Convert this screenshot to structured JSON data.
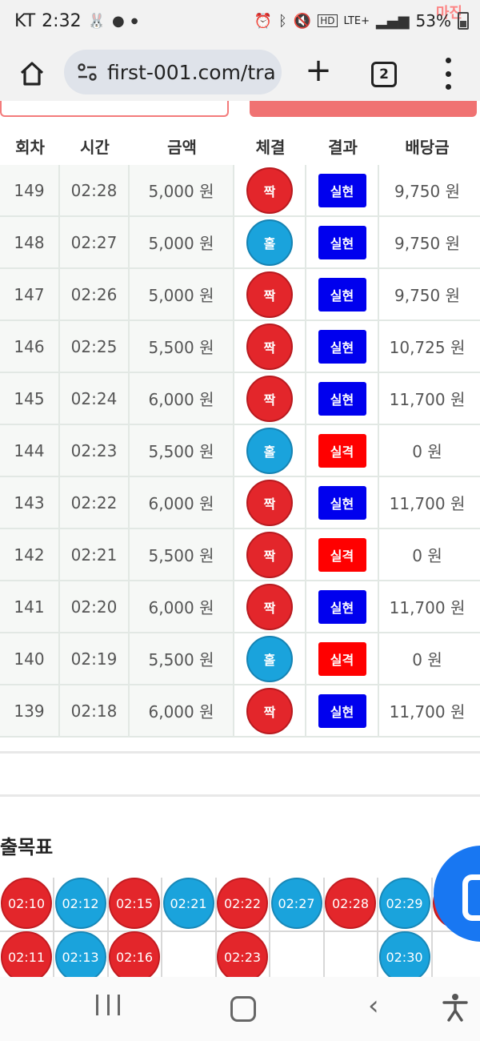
{
  "status_bar": {
    "carrier": "KT",
    "time": "2:32",
    "network": "LTE+",
    "battery": "53%",
    "watermark": "마진"
  },
  "browser": {
    "url": "first-001.com/tra",
    "tab_count": "2"
  },
  "table": {
    "headers": [
      "회차",
      "시간",
      "금액",
      "체결",
      "결과",
      "배당금"
    ],
    "rows": [
      {
        "round": "149",
        "time": "02:28",
        "amount": "5,000 원",
        "pick": "짝",
        "pick_color": "red",
        "result": "실현",
        "result_color": "blue",
        "payout": "9,750 원"
      },
      {
        "round": "148",
        "time": "02:27",
        "amount": "5,000 원",
        "pick": "홀",
        "pick_color": "blue",
        "result": "실현",
        "result_color": "blue",
        "payout": "9,750 원"
      },
      {
        "round": "147",
        "time": "02:26",
        "amount": "5,000 원",
        "pick": "짝",
        "pick_color": "red",
        "result": "실현",
        "result_color": "blue",
        "payout": "9,750 원"
      },
      {
        "round": "146",
        "time": "02:25",
        "amount": "5,500 원",
        "pick": "짝",
        "pick_color": "red",
        "result": "실현",
        "result_color": "blue",
        "payout": "10,725 원"
      },
      {
        "round": "145",
        "time": "02:24",
        "amount": "6,000 원",
        "pick": "짝",
        "pick_color": "red",
        "result": "실현",
        "result_color": "blue",
        "payout": "11,700 원"
      },
      {
        "round": "144",
        "time": "02:23",
        "amount": "5,500 원",
        "pick": "홀",
        "pick_color": "blue",
        "result": "실격",
        "result_color": "red",
        "payout": "0 원"
      },
      {
        "round": "143",
        "time": "02:22",
        "amount": "6,000 원",
        "pick": "짝",
        "pick_color": "red",
        "result": "실현",
        "result_color": "blue",
        "payout": "11,700 원"
      },
      {
        "round": "142",
        "time": "02:21",
        "amount": "5,500 원",
        "pick": "짝",
        "pick_color": "red",
        "result": "실격",
        "result_color": "red",
        "payout": "0 원"
      },
      {
        "round": "141",
        "time": "02:20",
        "amount": "6,000 원",
        "pick": "짝",
        "pick_color": "red",
        "result": "실현",
        "result_color": "blue",
        "payout": "11,700 원"
      },
      {
        "round": "140",
        "time": "02:19",
        "amount": "5,500 원",
        "pick": "홀",
        "pick_color": "blue",
        "result": "실격",
        "result_color": "red",
        "payout": "0 원"
      },
      {
        "round": "139",
        "time": "02:18",
        "amount": "6,000 원",
        "pick": "짝",
        "pick_color": "red",
        "result": "실현",
        "result_color": "blue",
        "payout": "11,700 원"
      }
    ]
  },
  "chart_section": {
    "title": "출목표",
    "columns": [
      {
        "color": "red",
        "times": [
          "02:10",
          "02:11"
        ]
      },
      {
        "color": "blue",
        "times": [
          "02:12",
          "02:13"
        ]
      },
      {
        "color": "red",
        "times": [
          "02:15",
          "02:16"
        ]
      },
      {
        "color": "blue",
        "times": [
          "02:21"
        ]
      },
      {
        "color": "red",
        "times": [
          "02:22",
          "02:23"
        ]
      },
      {
        "color": "blue",
        "times": [
          "02:27"
        ]
      },
      {
        "color": "red",
        "times": [
          "02:28"
        ]
      },
      {
        "color": "blue",
        "times": [
          "02:29",
          "02:30"
        ]
      },
      {
        "color": "red",
        "times": [
          ""
        ]
      }
    ]
  },
  "colors": {
    "pick_red": "#e3262b",
    "pick_blue": "#1aa3dc",
    "result_blue": "#0000ee",
    "result_red": "#ff0000",
    "fab": "#1877f2"
  },
  "icons": {
    "home": "home-icon",
    "tune": "site-settings-icon",
    "new_tab": "plus-icon",
    "tabs": "tab-switcher-icon",
    "menu": "more-vert-icon",
    "chat": "chat-icon",
    "nav_recent": "recent-apps-icon",
    "nav_home": "nav-home-icon",
    "nav_back": "back-icon",
    "accessibility": "accessibility-icon"
  }
}
